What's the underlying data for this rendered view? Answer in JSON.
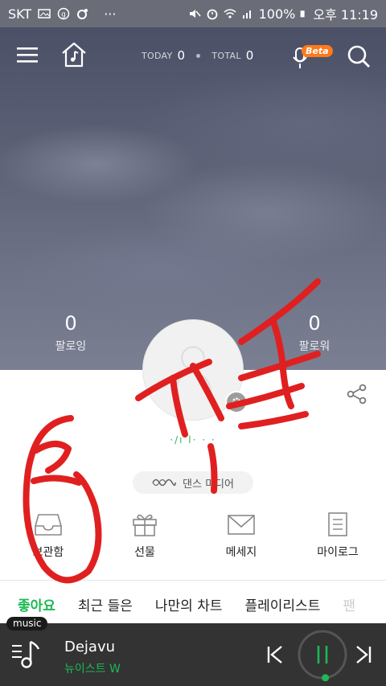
{
  "status_bar": {
    "carrier": "SKT",
    "battery": "100%",
    "time": "오후 11:19",
    "overflow": "···"
  },
  "header": {
    "today_label": "TODAY",
    "today_count": "0",
    "total_label": "TOTAL",
    "total_count": "0",
    "beta_label": "Beta",
    "icons": [
      "menu-icon",
      "home-music-icon",
      "microphone-icon",
      "search-icon"
    ]
  },
  "profile": {
    "following_count": "0",
    "following_label": "팔로잉",
    "follower_count": "0",
    "follower_label": "팔로워",
    "nickname": "·/ı l· ·  ·",
    "genre": "댄스 미디어"
  },
  "quick_menu": [
    {
      "label": "보관함",
      "icon": "inbox-icon"
    },
    {
      "label": "선물",
      "icon": "gift-icon"
    },
    {
      "label": "메세지",
      "icon": "mail-icon"
    },
    {
      "label": "마이로그",
      "icon": "log-icon"
    }
  ],
  "tabs": [
    {
      "label": "좋아요",
      "active": true
    },
    {
      "label": "최근 들은",
      "active": false
    },
    {
      "label": "나만의 차트",
      "active": false
    },
    {
      "label": "플레이리스트",
      "active": false
    },
    {
      "label": "팬",
      "active": false
    }
  ],
  "player": {
    "badge": "music",
    "title": "Dejavu",
    "artist": "뉴이스트 W",
    "progress": 0.02
  },
  "colors": {
    "accent": "#1db954",
    "beta": "#ff7a1a",
    "player_bg": "#333333",
    "annotation": "#e02020"
  }
}
